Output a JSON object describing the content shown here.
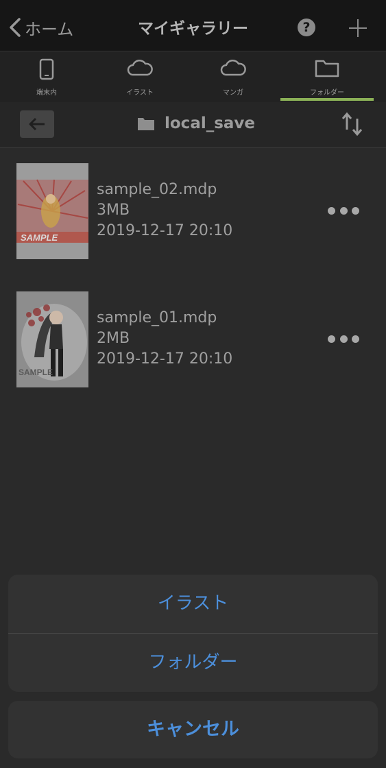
{
  "nav": {
    "back_label": "ホーム",
    "title": "マイギャラリー",
    "help_glyph": "?"
  },
  "tabs": [
    {
      "label": "端末内",
      "icon": "phone-icon"
    },
    {
      "label": "イラスト",
      "icon": "cloud-icon"
    },
    {
      "label": "マンガ",
      "icon": "cloud-icon"
    },
    {
      "label": "フォルダー",
      "icon": "folder-icon",
      "selected": true
    }
  ],
  "path": {
    "folder_name": "local_save"
  },
  "files": [
    {
      "name": "sample_02.mdp",
      "size": "3MB",
      "date": "2019-12-17 20:10",
      "thumb_text": "SAMPLE"
    },
    {
      "name": "sample_01.mdp",
      "size": "2MB",
      "date": "2019-12-17 20:10",
      "thumb_text": "SAMPLE"
    }
  ],
  "sheet": {
    "options": [
      "イラスト",
      "フォルダー"
    ],
    "cancel": "キャンセル"
  },
  "colors": {
    "accent": "#8bb157",
    "action": "#4c8fdb"
  }
}
